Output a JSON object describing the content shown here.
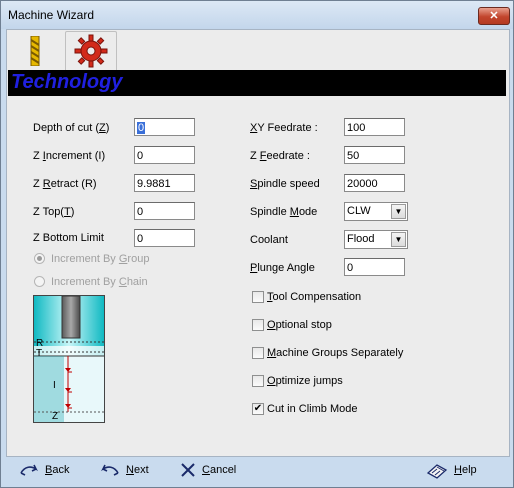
{
  "window": {
    "title": "Machine Wizard",
    "close_label": "✕"
  },
  "tabs": [
    {
      "icon": "drill-bit-icon"
    },
    {
      "icon": "gear-icon"
    }
  ],
  "header": {
    "title": "Technology"
  },
  "left_fields": [
    {
      "label_pre": "Depth of cut (",
      "label_key": "Z",
      "label_post": ")",
      "value": "0"
    },
    {
      "label_pre": "Z ",
      "label_key": "I",
      "label_post": "ncrement (I)",
      "value": "0"
    },
    {
      "label_pre": "Z ",
      "label_key": "R",
      "label_post": "etract (R)",
      "value": "9.9881"
    },
    {
      "label_pre": "Z Top(",
      "label_key": "T",
      "label_post": ")",
      "value": "0"
    },
    {
      "label_pre": "Z Bottom Limit",
      "label_key": "",
      "label_post": "",
      "value": "0"
    }
  ],
  "increment_radios": [
    {
      "label_pre": "Increment By ",
      "label_key": "G",
      "label_post": "roup",
      "selected": true
    },
    {
      "label_pre": "Increment By ",
      "label_key": "C",
      "label_post": "hain",
      "selected": false
    }
  ],
  "right_fields": [
    {
      "label_pre": "",
      "label_key": "X",
      "label_post": "Y Feedrate :",
      "value": "100"
    },
    {
      "label_pre": "Z ",
      "label_key": "F",
      "label_post": "eedrate :",
      "value": "50"
    },
    {
      "label_pre": "",
      "label_key": "S",
      "label_post": "pindle speed",
      "value": "20000"
    }
  ],
  "spindle_mode": {
    "label_pre": "Spindle ",
    "label_key": "M",
    "label_post": "ode",
    "value": "CLW"
  },
  "coolant": {
    "label_pre": "Coolant",
    "label_key": "",
    "label_post": "",
    "value": "Flood"
  },
  "plunge_angle": {
    "label_pre": "",
    "label_key": "P",
    "label_post": "lunge Angle",
    "value": "0"
  },
  "checkboxes": [
    {
      "label_pre": "",
      "label_key": "T",
      "label_post": "ool Compensation",
      "checked": false
    },
    {
      "label_pre": "",
      "label_key": "O",
      "label_post": "ptional stop",
      "checked": false
    },
    {
      "label_pre": "",
      "label_key": "M",
      "label_post": "achine Groups Separately",
      "checked": false
    },
    {
      "label_pre": "",
      "label_key": "O",
      "label_post": "ptimize jumps",
      "checked": false
    },
    {
      "label_pre": "Cut in Climb Mode",
      "label_key": "",
      "label_post": "",
      "checked": true
    }
  ],
  "diagram": {
    "labels": [
      "R",
      "T",
      "I",
      "Z"
    ]
  },
  "footer": {
    "back": {
      "label_pre": "",
      "label_key": "B",
      "label_post": "ack"
    },
    "next": {
      "label_pre": "",
      "label_key": "N",
      "label_post": "ext"
    },
    "cancel": {
      "label_pre": "",
      "label_key": "C",
      "label_post": "ancel"
    },
    "help": {
      "label_pre": "",
      "label_key": "H",
      "label_post": "elp"
    }
  },
  "colors": {
    "header_bg": "#000000",
    "header_text": "#2020e0",
    "diagram_cyan": "#19c8d0",
    "window_frame": "#c9dbee"
  }
}
